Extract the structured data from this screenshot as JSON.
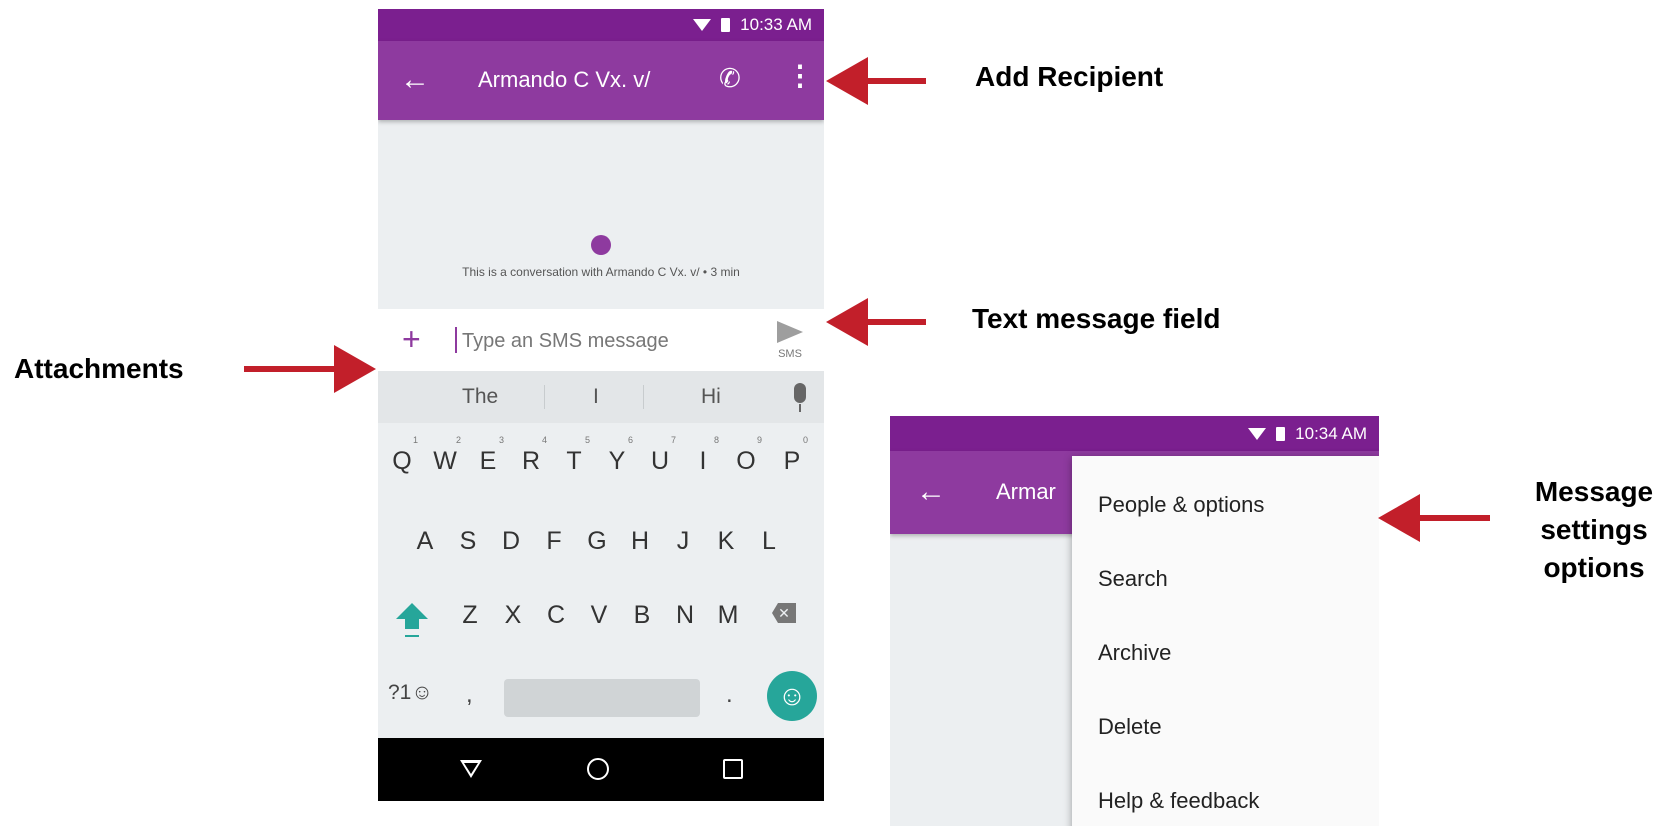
{
  "phone1": {
    "status": {
      "time": "10:33 AM"
    },
    "appbar": {
      "title": "Armando C Vx. v/"
    },
    "conversation": {
      "info": "This is a conversation with Armando C Vx. v/ • 3 min"
    },
    "compose": {
      "placeholder": "Type an SMS message",
      "send_label": "SMS"
    },
    "suggestions": [
      "The",
      "I",
      "Hi"
    ],
    "keyboard": {
      "row1": [
        "Q",
        "W",
        "E",
        "R",
        "T",
        "Y",
        "U",
        "I",
        "O",
        "P"
      ],
      "row1_numbers": [
        "1",
        "2",
        "3",
        "4",
        "5",
        "6",
        "7",
        "8",
        "9",
        "0"
      ],
      "row2": [
        "A",
        "S",
        "D",
        "F",
        "G",
        "H",
        "J",
        "K",
        "L"
      ],
      "row3": [
        "Z",
        "X",
        "C",
        "V",
        "B",
        "N",
        "M"
      ],
      "symbols_key": "?1☺",
      "comma": ",",
      "period": "."
    }
  },
  "phone2": {
    "status": {
      "time": "10:34 AM"
    },
    "appbar": {
      "title": "Armar"
    },
    "menu": [
      "People & options",
      "Search",
      "Archive",
      "Delete",
      "Help & feedback"
    ]
  },
  "annotations": {
    "add_recipient": "Add Recipient",
    "text_message_field": "Text message field",
    "attachments": "Attachments",
    "message_settings_line1": "Message",
    "message_settings_line2": "settings",
    "message_settings_line3": "options"
  },
  "colors": {
    "status_bar": "#7b1f8f",
    "app_bar": "#8e3a9f",
    "accent_teal": "#26a69a",
    "arrow_red": "#c21f2a"
  }
}
